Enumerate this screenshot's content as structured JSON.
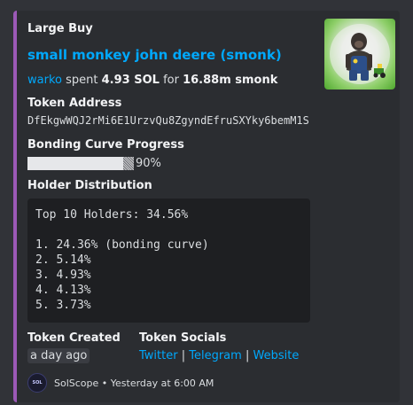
{
  "embed": {
    "accent_color": "#9b59b6",
    "author": "Large Buy",
    "title": "small monkey john deere (smonk)",
    "thumbnail_icon": "monkey-photo",
    "description": {
      "buyer": "warko",
      "spent_word": "spent",
      "sol_amount": "4.93 SOL",
      "for_word": "for",
      "token_amount": "16.88m smonk"
    },
    "fields": {
      "token_address": {
        "name": "Token Address",
        "value": "DfEkgwWQJ2rMi6E1UrzvQu8ZgyndEfruSXYky6bemM1S"
      },
      "bonding_curve": {
        "name": "Bonding Curve Progress",
        "percent_text": "90%",
        "progress": 0.9
      },
      "holder_distribution": {
        "name": "Holder Distribution",
        "summary": "Top 10 Holders: 34.56%",
        "holders": [
          "1. 24.36% (bonding curve)",
          "2. 5.14%",
          "3. 4.93%",
          "4. 4.13%",
          "5. 3.73%"
        ]
      },
      "token_created": {
        "name": "Token Created",
        "value": "a day ago"
      },
      "token_socials": {
        "name": "Token Socials",
        "twitter": "Twitter",
        "separator": "|",
        "telegram": "Telegram",
        "website": "Website"
      }
    },
    "footer": {
      "icon_text": "SOL",
      "text": "SolScope • Yesterday at 6:00 AM"
    }
  }
}
